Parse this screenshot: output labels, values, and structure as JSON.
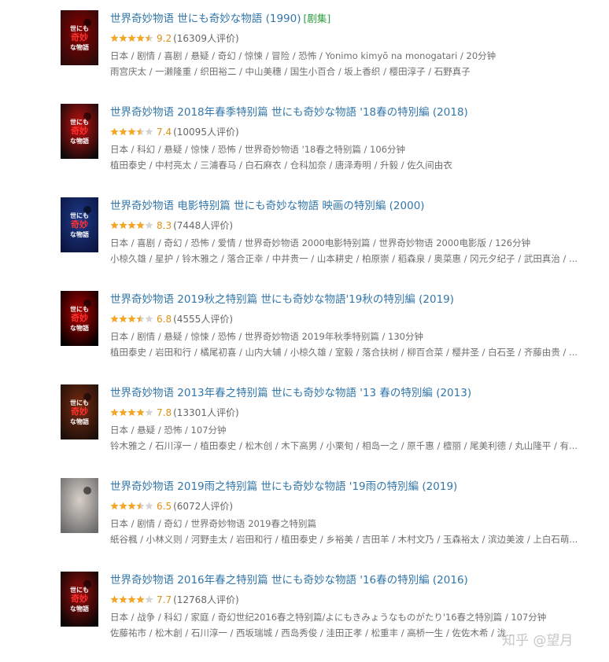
{
  "items": [
    {
      "title": "世界奇妙物语 世にも奇妙な物語 (1990)",
      "tag": "[剧集]",
      "rating": 9.2,
      "score": "9.2",
      "votes": "(16309人评价)",
      "meta": "日本 / 剧情 / 喜剧 / 悬疑 / 奇幻 / 惊悚 / 冒险 / 恐怖 / Yonimo kimyō na monogatari / 20分钟",
      "cast": "雨宫庆太 / 一濑隆重 / 织田裕二 / 中山美穗 / 国生小百合 / 坂上香织 / 樱田淳子 / 石野真子",
      "poster_lines": [
        "世にも",
        "奇妙",
        "な物語"
      ],
      "poster_colors": [
        "#2a0b0b",
        "#8b0000"
      ]
    },
    {
      "title": "世界奇妙物语 2018年春季特别篇 世にも奇妙な物語 '18春の特別編 (2018)",
      "tag": "",
      "rating": 7.4,
      "score": "7.4",
      "votes": "(10095人评价)",
      "meta": "日本 / 科幻 / 悬疑 / 惊悚 / 恐怖 / 世界奇妙物语 '18春之特别篇 / 106分钟",
      "cast": "植田泰史 / 中村亮太 / 三浦春马 / 白石麻衣 / 仓科加奈 / 唐泽寿明 / 升毅 / 佐久间由衣",
      "poster_lines": [
        "世にも",
        "奇妙",
        "な物語"
      ],
      "poster_colors": [
        "#0a0a0a",
        "#c41010"
      ]
    },
    {
      "title": "世界奇妙物语 电影特别篇 世にも奇妙な物語 映画の特別編 (2000)",
      "tag": "",
      "rating": 8.3,
      "score": "8.3",
      "votes": "(7448人评价)",
      "meta": "日本 / 喜剧 / 奇幻 / 恐怖 / 爱情 / 世界奇妙物语 2000电影特别篇 / 世界奇妙物语 2000电影版 / 126分钟",
      "cast": "小椋久雄 / 星护 / 铃木雅之 / 落合正幸 / 中井贵一 / 山本耕史 / 柏原崇 / 稻森泉 / 奥菜惠 / 冈元夕纪子 / 武田真治 / ...",
      "poster_lines": [
        "世にも",
        "奇妙",
        "な物語"
      ],
      "poster_colors": [
        "#0b1540",
        "#1e3a8a"
      ]
    },
    {
      "title": "世界奇妙物语 2019秋之特别篇 世にも奇妙な物語'19秋の特別編 (2019)",
      "tag": "",
      "rating": 6.8,
      "score": "6.8",
      "votes": "(4555人评价)",
      "meta": "日本 / 剧情 / 悬疑 / 惊悚 / 恐怖 / 世界奇妙物语 2019年秋季特别篇 / 130分钟",
      "cast": "植田泰史 / 岩田和行 / 橘尾初喜 / 山内大辅 / 小椋久雄 / 室毅 / 落合扶树 / 柳百合菜 / 樱井圣 / 白石圣 / 齐藤由贵 / ...",
      "poster_lines": [
        "世にも",
        "奇妙",
        "な物語"
      ],
      "poster_colors": [
        "#000000",
        "#b30000"
      ]
    },
    {
      "title": "世界奇妙物语 2013年春之特别篇 世にも奇妙な物語 '13 春の特別編 (2013)",
      "tag": "",
      "rating": 7.8,
      "score": "7.8",
      "votes": "(13301人评价)",
      "meta": "日本 / 悬疑 / 恐怖 / 107分钟",
      "cast": "铃木雅之 / 石川淳一 / 植田泰史 / 松木创 / 木下高男 / 小栗旬 / 相岛一之 / 原千惠 / 檀丽 / 尾美利德 / 丸山隆平 / 有...",
      "poster_lines": [
        "世にも",
        "奇妙",
        "な物語"
      ],
      "poster_colors": [
        "#1a0f0a",
        "#7a2a10"
      ]
    },
    {
      "title": "世界奇妙物语 2019雨之特别篇 世にも奇妙な物語 '19雨の特別編 (2019)",
      "tag": "",
      "rating": 6.5,
      "score": "6.5",
      "votes": "(6072人评价)",
      "meta": "日本 / 剧情 / 奇幻 / 世界奇妙物语 2019春之特别篇",
      "cast": "紙谷楓 / 小林义则 / 河野圭太 / 岩田和行 / 植田泰史 / 乡裕美 / 吉田羊 / 木村文乃 / 玉森裕太 / 滨边美波 / 上白石萌...",
      "poster_lines": [
        "",
        "",
        ""
      ],
      "poster_colors": [
        "#6b6b6b",
        "#d8d0c8"
      ]
    },
    {
      "title": "世界奇妙物语 2016年春之特别篇 世にも奇妙な物語 '16春の特別編 (2016)",
      "tag": "",
      "rating": 7.7,
      "score": "7.7",
      "votes": "(12768人评价)",
      "meta": "日本 / 战争 / 科幻 / 家庭 / 奇幻世纪2016春之特别篇/よにもきみょうなものがたり'16春之特別篇 / 107分钟",
      "cast": "佐藤祐市 / 松木創 / 石川淳一 / 西坂瑞城 / 西岛秀俊 / 洼田正孝 / 松重丰 / 高桥一生 / 佐佐木希 / 泷...",
      "poster_lines": [
        "世にも",
        "奇妙",
        "な物語"
      ],
      "poster_colors": [
        "#050505",
        "#9a0d0d"
      ]
    }
  ],
  "watermark": "知乎 @望月",
  "colors": {
    "title": "#3377aa",
    "tag": "#2a9d3c",
    "score": "#e09015",
    "star_on": "#f5a623",
    "star_off": "#d4d4d4"
  }
}
